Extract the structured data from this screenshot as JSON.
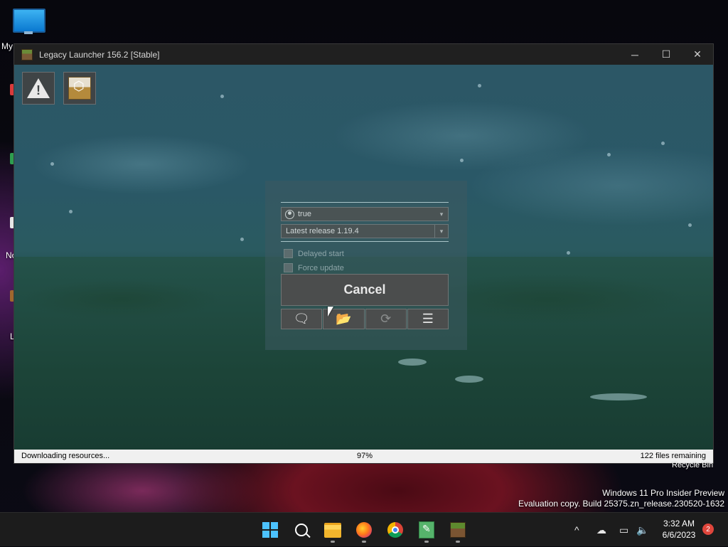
{
  "desktop": {
    "icons": [
      {
        "label": "My",
        "icon": "monitor-icon"
      },
      {
        "label": "No",
        "icon": "notepad-icon"
      },
      {
        "label": "L",
        "icon": "launcher-icon"
      }
    ],
    "recycle_bin_label": "Recycle Bin",
    "watermark_line1": "Windows 11 Pro Insider Preview",
    "watermark_line2": "Evaluation copy. Build 25375.zn_release.230520-1632"
  },
  "window": {
    "title": "Legacy Launcher 156.2 [Stable]",
    "controls": [
      "minimize-icon",
      "maximize-icon",
      "close-icon"
    ],
    "minimize_glyph": "─",
    "maximize_glyph": "☐",
    "close_glyph": "✕"
  },
  "corner_buttons": [
    {
      "name": "warning-icon"
    },
    {
      "name": "tlauncher-cube-icon"
    }
  ],
  "panel": {
    "account_value": "true",
    "version_value": "Latest release 1.19.4",
    "delayed_start_label": "Delayed start",
    "force_update_label": "Force update",
    "delayed_start_checked": false,
    "force_update_checked": false,
    "cancel_label": "Cancel",
    "tools": [
      {
        "icon": "chat-icon",
        "glyph": "🗨"
      },
      {
        "icon": "folder-open-icon",
        "glyph": "📂"
      },
      {
        "icon": "refresh-icon",
        "glyph": "⟳"
      },
      {
        "icon": "menu-icon",
        "glyph": "☰"
      }
    ]
  },
  "status": {
    "left": "Downloading resources...",
    "percent": "97%",
    "progress": 0.97,
    "right": "122 files remaining"
  },
  "taskbar": {
    "apps": [
      "start-icon",
      "search-icon",
      "file-explorer-icon",
      "firefox-icon",
      "chrome-icon",
      "notepad-plus-icon",
      "minecraft-launcher-icon"
    ],
    "tray_chevron": "^",
    "time": "3:32 AM",
    "date": "6/6/2023",
    "notification_count": "2"
  },
  "colors": {
    "accent": "#4cc2ff",
    "window_chrome": "#202020",
    "panel_bg": "#4b4d4d"
  }
}
